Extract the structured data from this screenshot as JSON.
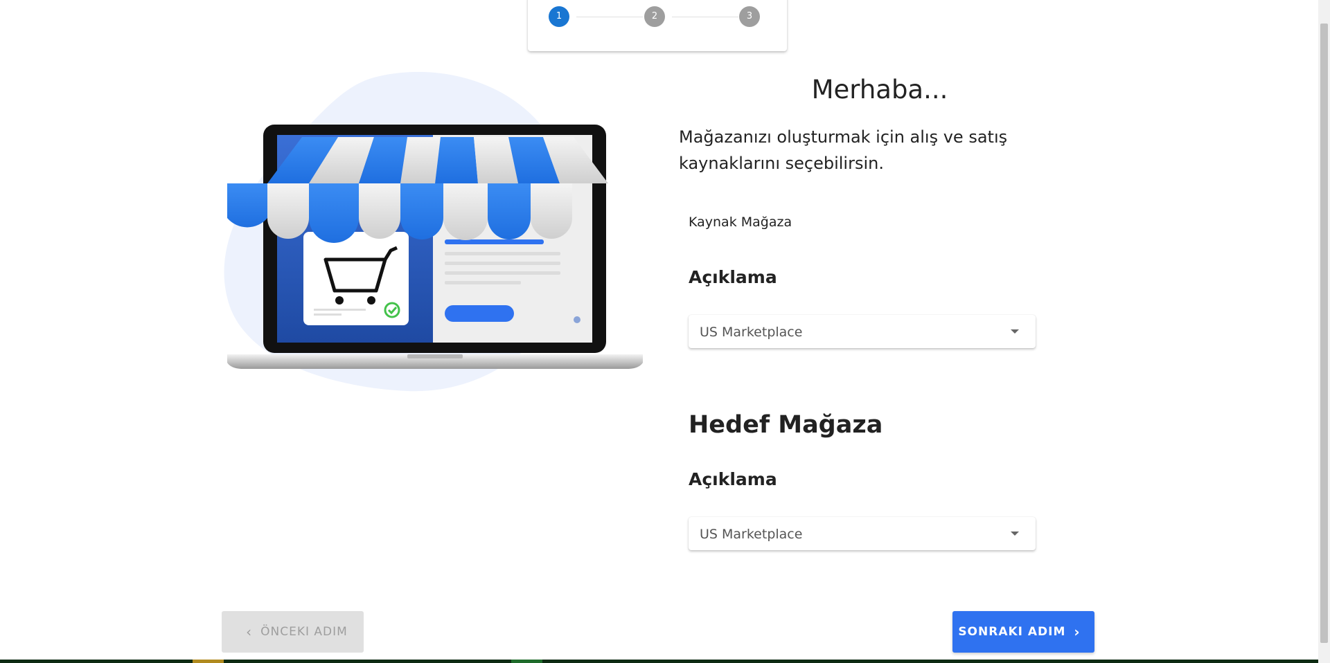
{
  "stepper": {
    "steps": [
      {
        "label": "1",
        "state": "active"
      },
      {
        "label": "2",
        "state": "inactive"
      },
      {
        "label": "3",
        "state": "inactive"
      }
    ],
    "active_color": "#1976d2",
    "inactive_color": "#9e9e9e"
  },
  "header": {
    "title": "Merhaba...",
    "intro": "Mağazanızı oluşturmak için alış ve satış kaynaklarını seçebilirsin."
  },
  "source_store": {
    "label": "Kaynak Mağaza",
    "description_label": "Açıklama",
    "select_value": "US Marketplace"
  },
  "target_store": {
    "title": "Hedef Mağaza",
    "description_label": "Açıklama",
    "select_value": "US Marketplace"
  },
  "buttons": {
    "prev_label": "ÖNCEKI ADIM",
    "next_label": "SONRAKI ADIM"
  },
  "icons": {
    "prev": "chevron-left-icon",
    "next": "chevron-right-icon",
    "select_caret": "caret-down-icon"
  },
  "colors": {
    "primary": "#2f72f0",
    "disabled_bg": "#e0e0e0",
    "disabled_text": "#9e9e9e",
    "awning_blue": "#2a7de9",
    "blob_bg": "#edf2fd"
  }
}
